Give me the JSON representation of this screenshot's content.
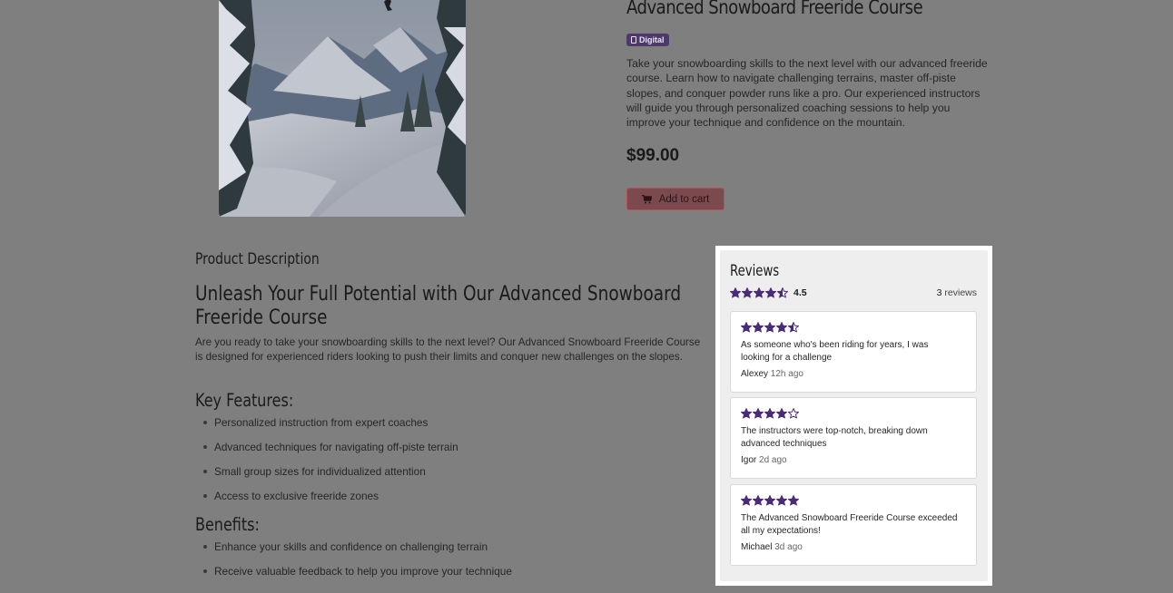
{
  "product": {
    "title": "Advanced Snowboard Freeride Course",
    "badge_label": "Digital",
    "summary": "Take your snowboarding skills to the next level with our advanced freeride course. Learn how to navigate challenging terrains, master off-piste slopes, and conquer powder runs like a pro. Our experienced instructors will guide you through personalized coaching sessions to help you improve your technique and confidence on the mountain.",
    "price": "$99.00",
    "add_to_cart_label": "Add to cart",
    "image_icon": "snowboarder-mountain-image"
  },
  "description": {
    "section_heading": "Product Description",
    "title": "Unleash Your Full Potential with Our Advanced Snowboard Freeride Course",
    "intro": "Are you ready to take your snowboarding skills to the next level? Our Advanced Snowboard Freeride Course is designed for experienced riders looking to push their limits and conquer new challenges on the slopes.",
    "features_heading": "Key Features:",
    "features": [
      "Personalized instruction from expert coaches",
      "Advanced techniques for navigating off-piste terrain",
      "Small group sizes for individualized attention",
      "Access to exclusive freeride zones"
    ],
    "benefits_heading": "Benefits:",
    "benefits": [
      "Enhance your skills and confidence on challenging terrain",
      "Receive valuable feedback to help you improve your technique"
    ]
  },
  "reviews": {
    "title": "Reviews",
    "average": "4.5",
    "average_stars": 4.5,
    "count": "3",
    "count_label": "reviews",
    "items": [
      {
        "rating": 4.5,
        "text": "As someone who's been riding for years, I was looking for a challenge",
        "author": "Alexey",
        "time": "12h ago"
      },
      {
        "rating": 4,
        "text": "The instructors were top-notch, breaking down advanced techniques",
        "author": "Igor",
        "time": "2d ago"
      },
      {
        "rating": 5,
        "text": "The Advanced Snowboard Freeride Course exceeded all my expectations!",
        "author": "Michael",
        "time": "3d ago"
      }
    ]
  },
  "colors": {
    "overlay_background": "#7f7f7f",
    "star": "#4b2a78",
    "badge": "#4e3a6a",
    "cart_button": "#7b4a4f",
    "highlight": "#ffffff"
  }
}
